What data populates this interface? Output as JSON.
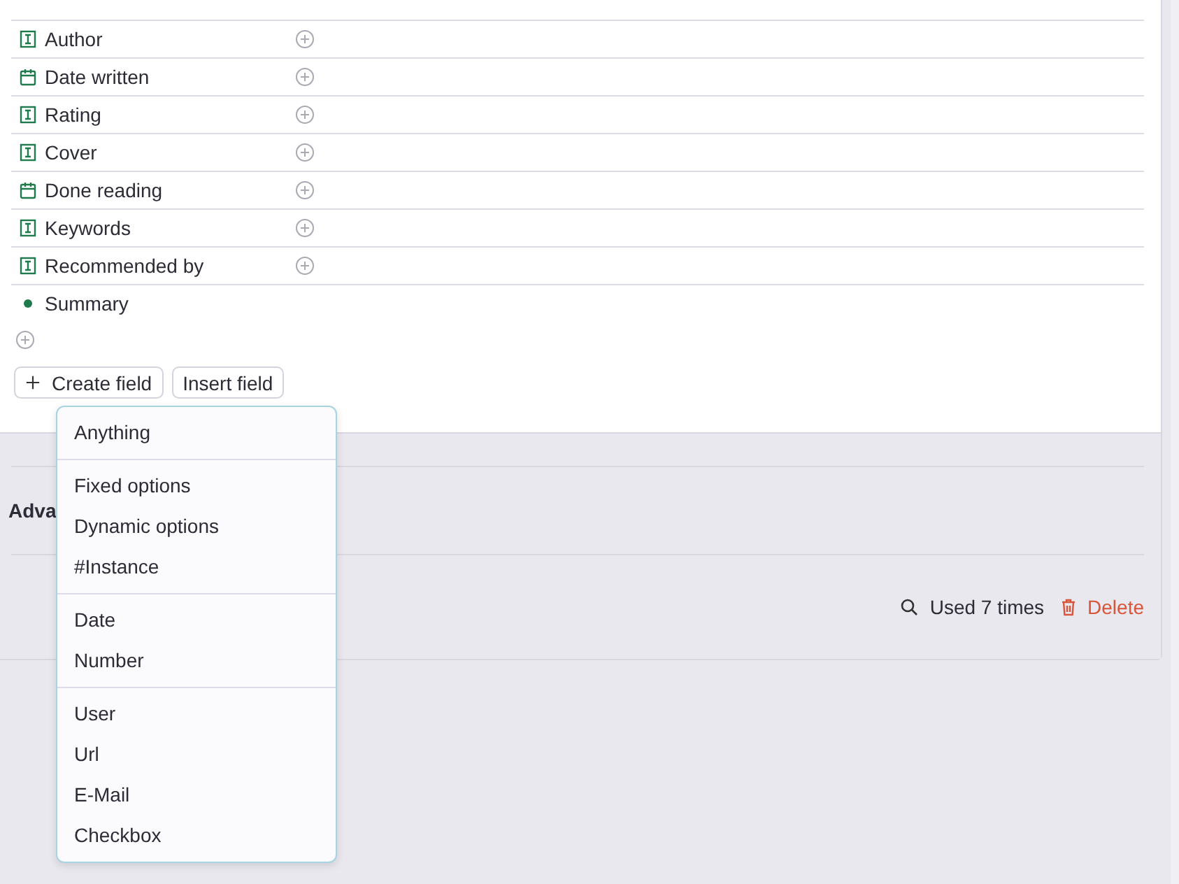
{
  "fields": [
    {
      "label": "Author",
      "kind": "text",
      "addable": true
    },
    {
      "label": "Date written",
      "kind": "date",
      "addable": true
    },
    {
      "label": "Rating",
      "kind": "text",
      "addable": true
    },
    {
      "label": "Cover",
      "kind": "text",
      "addable": true
    },
    {
      "label": "Done reading",
      "kind": "date",
      "addable": true
    },
    {
      "label": "Keywords",
      "kind": "text",
      "addable": true
    },
    {
      "label": "Recommended by",
      "kind": "text",
      "addable": true
    },
    {
      "label": "Summary",
      "kind": "dot",
      "addable": false
    }
  ],
  "buttons": [
    {
      "label": "Create field",
      "kind": "create"
    },
    {
      "label": "Insert field",
      "kind": "insert"
    }
  ],
  "advanced": {
    "heading": "Adva"
  },
  "footer": {
    "usage": "Used 7 times",
    "delete": "Delete"
  },
  "menu": {
    "groups": [
      [
        "Anything"
      ],
      [
        "Fixed options",
        "Dynamic options",
        "#Instance"
      ],
      [
        "Date",
        "Number"
      ],
      [
        "User",
        "Url",
        "E-Mail",
        "Checkbox"
      ]
    ]
  }
}
